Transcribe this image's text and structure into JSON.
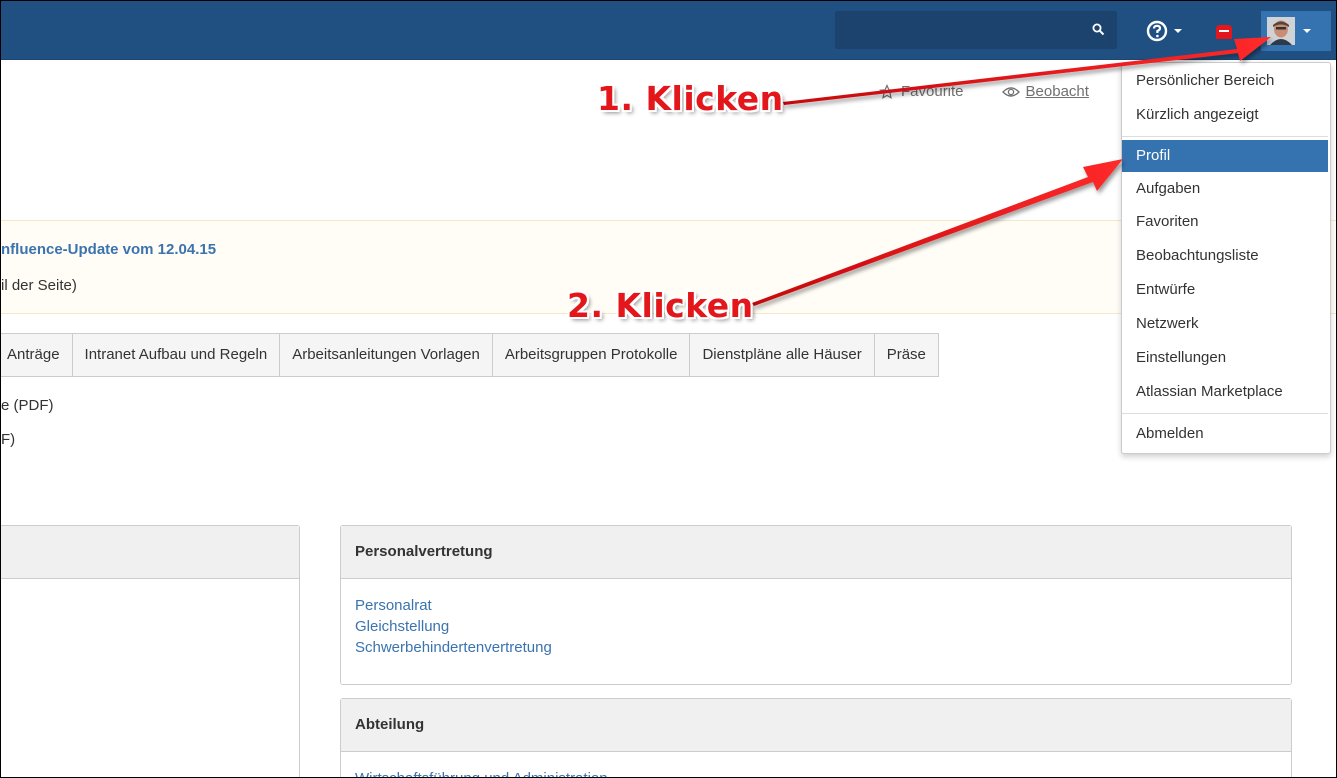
{
  "header": {
    "search_placeholder": "",
    "icons": [
      "search-icon",
      "help-icon",
      "notification-icon",
      "avatar"
    ]
  },
  "page_actions": {
    "favourite": "Favourite",
    "watch": "Beobacht"
  },
  "banner": {
    "title": "nfluence-Update vom 12.04.15",
    "subtitle": "il der Seite)"
  },
  "tabs": [
    "Anträge",
    "Intranet Aufbau und Regeln",
    "Arbeitsanleitungen Vorlagen",
    "Arbeitsgruppen Protokolle",
    "Dienstpläne alle Häuser",
    "Präse"
  ],
  "pdf_lines": [
    "e (PDF)",
    "F)"
  ],
  "panels": {
    "personalvertretung": {
      "title": "Personalvertretung",
      "links": [
        "Personalrat",
        "Gleichstellung",
        "Schwerbehindertenvertretung"
      ]
    },
    "abteilung": {
      "title": "Abteilung",
      "links": [
        "Wirtschaftsführung und Administration"
      ]
    }
  },
  "user_menu": {
    "items": [
      "Persönlicher Bereich",
      "Kürzlich angezeigt",
      "Profil",
      "Aufgaben",
      "Favoriten",
      "Beobachtungsliste",
      "Entwürfe",
      "Netzwerk",
      "Einstellungen",
      "Atlassian Marketplace",
      "Abmelden"
    ],
    "active": "Profil"
  },
  "annotations": {
    "step1": "1. Klicken",
    "step2": "2. Klicken"
  },
  "colors": {
    "header": "#205081",
    "link": "#3b73af",
    "menu_active": "#3572b0",
    "annotation": "#e3161b"
  }
}
